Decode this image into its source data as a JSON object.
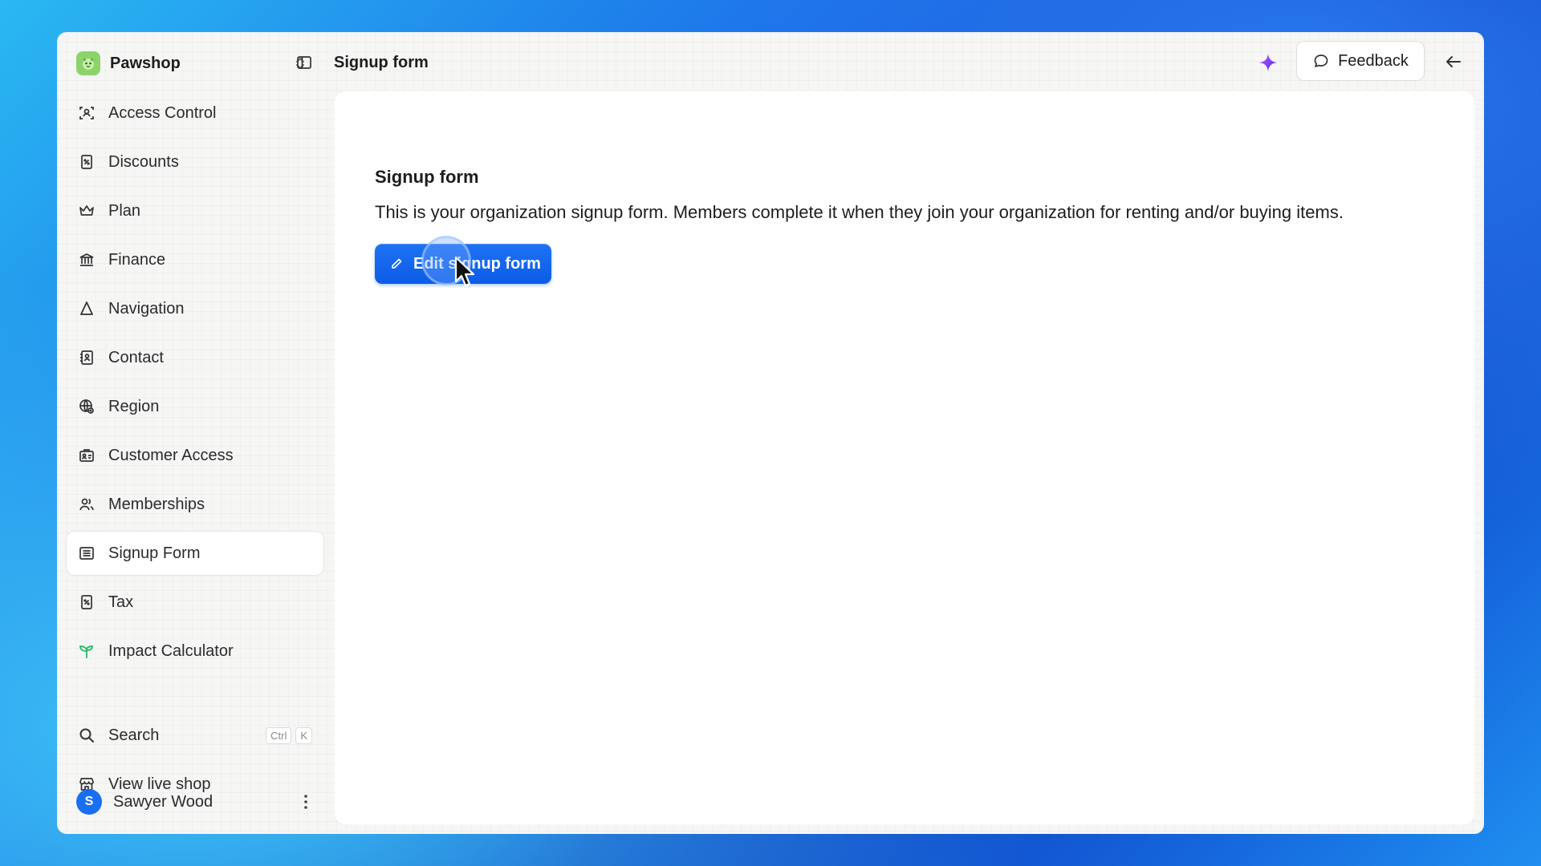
{
  "app": {
    "brand_name": "Pawshop",
    "page_heading": "Signup form"
  },
  "sidebar": {
    "items": [
      {
        "label": "Access Control",
        "icon": "access-control-icon"
      },
      {
        "label": "Discounts",
        "icon": "discount-icon"
      },
      {
        "label": "Plan",
        "icon": "crown-icon"
      },
      {
        "label": "Finance",
        "icon": "bank-icon"
      },
      {
        "label": "Navigation",
        "icon": "navigation-icon"
      },
      {
        "label": "Contact",
        "icon": "contact-card-icon"
      },
      {
        "label": "Region",
        "icon": "globe-icon"
      },
      {
        "label": "Customer Access",
        "icon": "customer-access-icon"
      },
      {
        "label": "Memberships",
        "icon": "users-icon"
      },
      {
        "label": "Signup Form",
        "icon": "form-list-icon",
        "active": true
      },
      {
        "label": "Tax",
        "icon": "tax-icon"
      },
      {
        "label": "Impact Calculator",
        "icon": "sprout-icon"
      }
    ],
    "search_label": "Search",
    "search_shortcut": [
      "Ctrl",
      "K"
    ],
    "live_shop_label": "View live shop",
    "user": {
      "initial": "S",
      "name": "Sawyer Wood"
    }
  },
  "topbar": {
    "feedback_label": "Feedback"
  },
  "content": {
    "title": "Signup form",
    "description": "This is your organization signup form. Members complete it when they join your organization for renting and/or buying items.",
    "edit_button_label": "Edit signup form"
  },
  "colors": {
    "accent": "#0c5ce6",
    "brand_logo": "#8bd36a",
    "sparkle": "#8a3ff0",
    "sprout": "#2fbf71"
  }
}
